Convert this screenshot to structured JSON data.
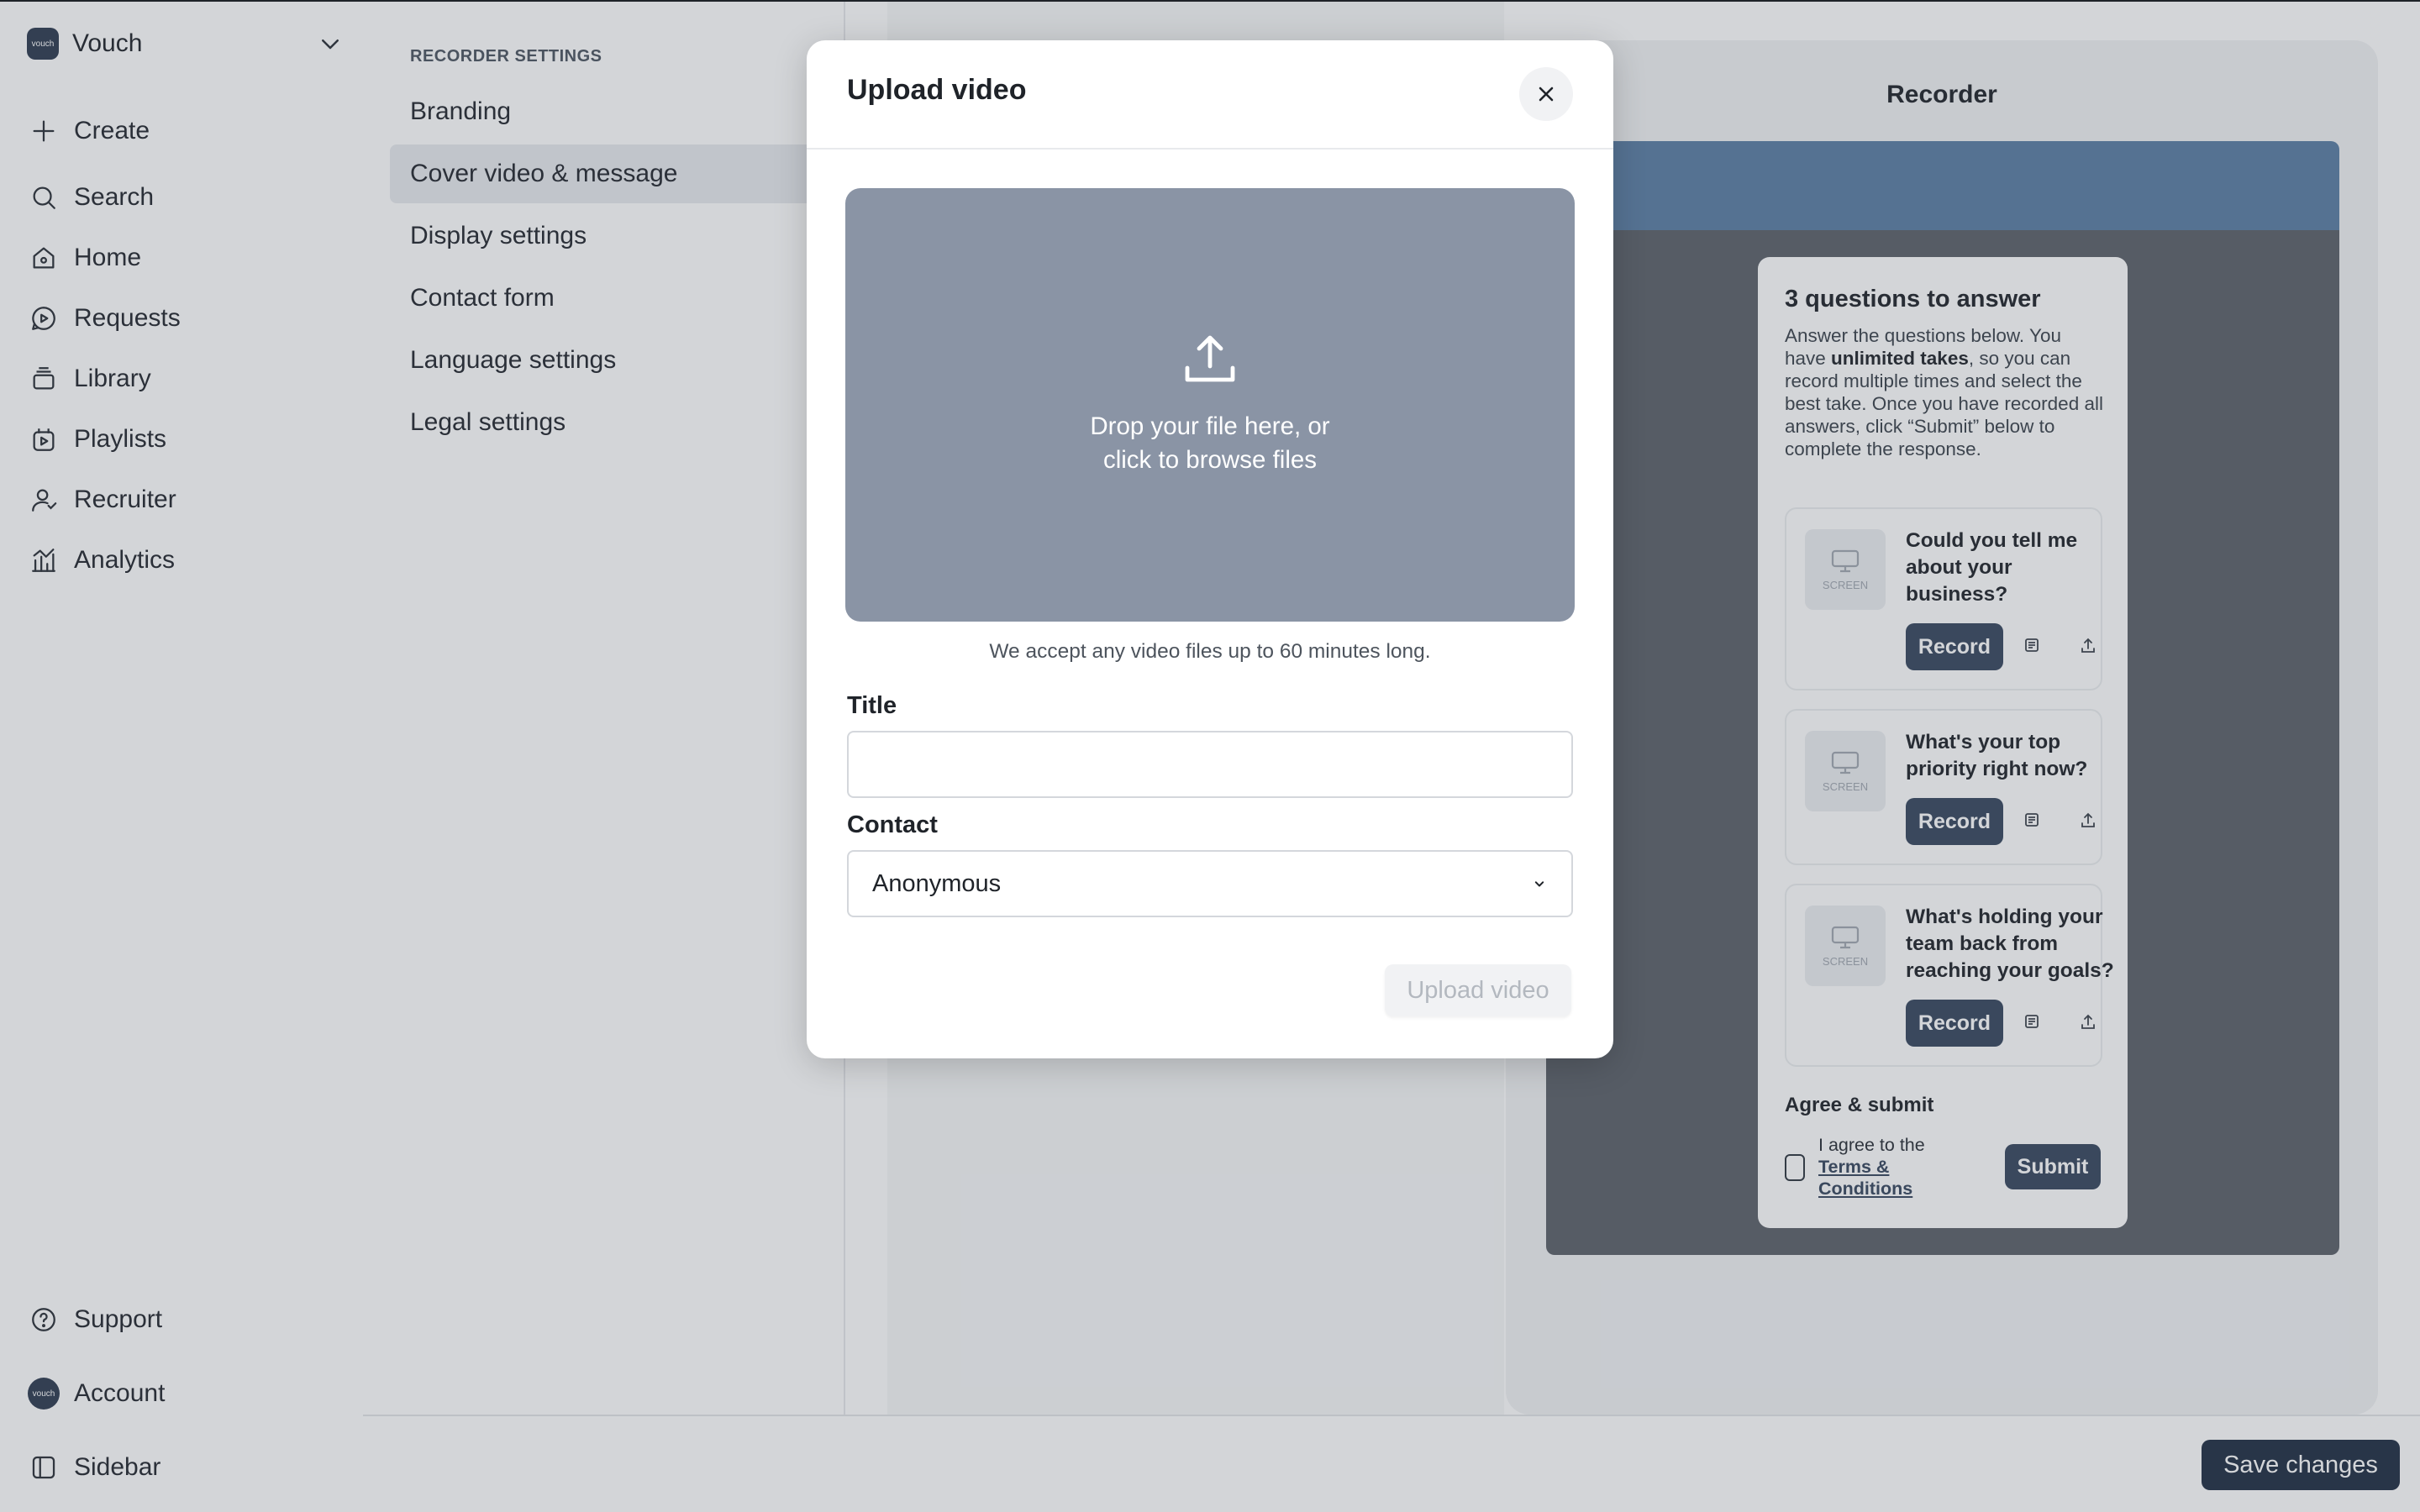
{
  "sidebar": {
    "workspace": {
      "logo_text": "vouch",
      "name": "Vouch"
    },
    "nav": [
      {
        "label": "Create",
        "icon": "plus-icon"
      },
      {
        "label": "Search",
        "icon": "search-icon"
      },
      {
        "label": "Home",
        "icon": "home-icon"
      },
      {
        "label": "Requests",
        "icon": "requests-icon"
      },
      {
        "label": "Library",
        "icon": "library-icon"
      },
      {
        "label": "Playlists",
        "icon": "playlists-icon"
      },
      {
        "label": "Recruiter",
        "icon": "recruiter-icon"
      },
      {
        "label": "Analytics",
        "icon": "analytics-icon"
      }
    ],
    "bottom": {
      "support": "Support",
      "account": "Account",
      "account_avatar": "vouch",
      "sidebar_toggle": "Sidebar"
    }
  },
  "settings": {
    "heading": "RECORDER SETTINGS",
    "items": [
      "Branding",
      "Cover video & message",
      "Display settings",
      "Contact form",
      "Language settings",
      "Legal settings"
    ],
    "active_index": 1
  },
  "preview": {
    "title": "Recorder",
    "card_title": "3 questions to answer",
    "description_parts": [
      "Answer the questions below. You have ",
      "unlimited takes",
      ", so you can record multiple times and select the best take. Once you have recorded all answers, click “Submit” below to complete the response."
    ],
    "thumb_label": "SCREEN",
    "questions": [
      {
        "text": "Could you tell me about your business?",
        "button": "Record"
      },
      {
        "text": "What's your top priority right now?",
        "button": "Record"
      },
      {
        "text": "What's holding your team back from reaching your goals?",
        "button": "Record"
      }
    ],
    "agree_heading": "Agree & submit",
    "agree_prefix": "I agree to the",
    "agree_link": "Terms & Conditions",
    "submit_label": "Submit"
  },
  "footer": {
    "save_label": "Save changes"
  },
  "modal": {
    "title": "Upload video",
    "dropzone_text": "Drop your file here, or click to browse files",
    "note": "We accept any video files up to 60 minutes long.",
    "title_label": "Title",
    "title_value": "",
    "contact_label": "Contact",
    "contact_value": "Anonymous",
    "upload_label": "Upload video"
  },
  "colors": {
    "brand_dark": "#1f2d42",
    "button_dark": "#36465e",
    "dropzone": "#8a94a5",
    "preview_header": "#5a7ea4"
  }
}
